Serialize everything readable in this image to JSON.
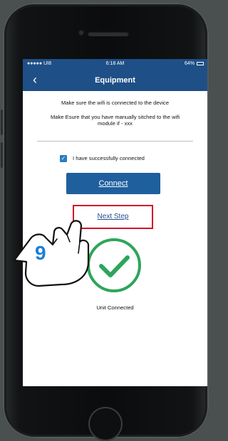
{
  "status_bar": {
    "carrier": "●●●●● UI8 ",
    "time": "6:18 AM",
    "battery": "64%"
  },
  "nav": {
    "back_icon": "chevron-left-icon",
    "title": "Equipment"
  },
  "instructions": {
    "line1": "Make sure the wifi is connected to the device",
    "line2": "Make Esure that you have manually sitched to the wifi",
    "line3": "module if - xxx"
  },
  "confirm": {
    "checked": true,
    "label": "I have successfully connected"
  },
  "buttons": {
    "connect": "Connect",
    "next_step": "Next Step"
  },
  "status": {
    "icon": "check-circle-icon",
    "label": "Unit Connected"
  },
  "annotation": {
    "step_number": "9"
  },
  "colors": {
    "navbar": "#1f4f87",
    "button": "#1f5f9e",
    "highlight": "#d0142a",
    "success": "#2ea55a",
    "step_number": "#1b7fd6"
  }
}
